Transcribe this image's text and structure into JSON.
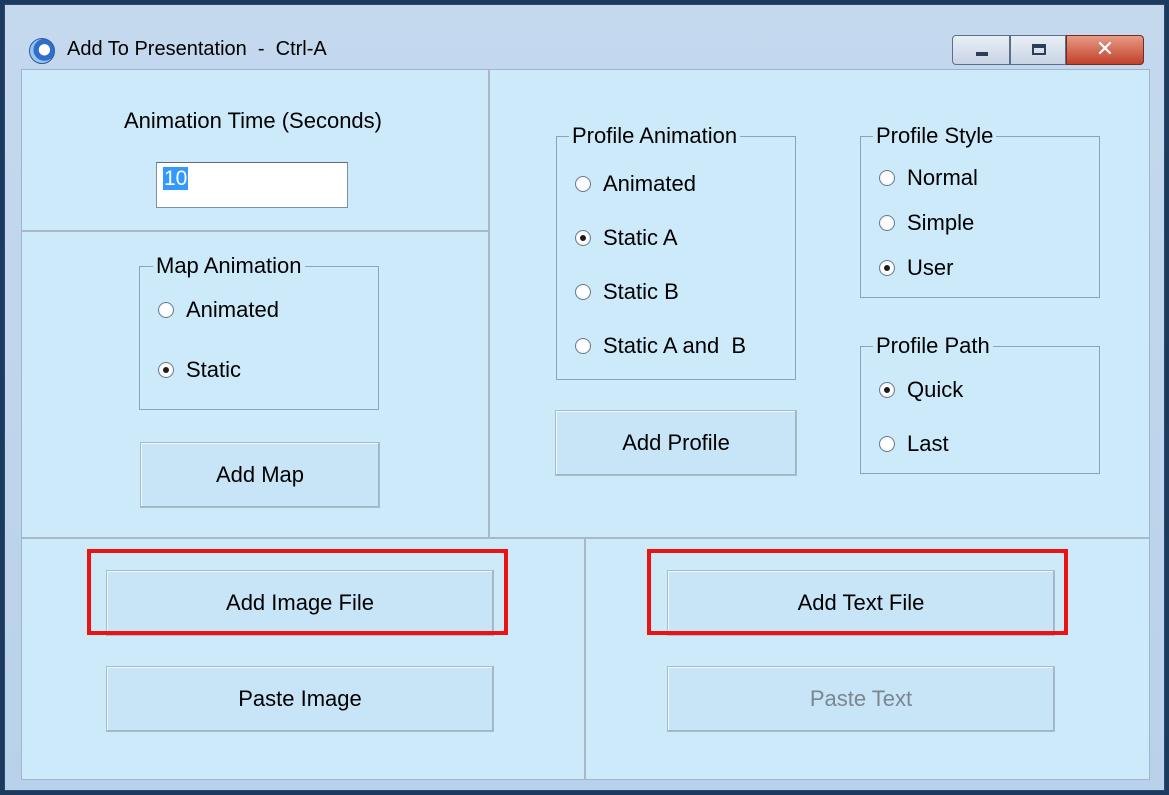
{
  "window": {
    "title": "Add To Presentation  -  Ctrl-A",
    "close_glyph": "✕"
  },
  "animation_time": {
    "label": "Animation Time (Seconds)",
    "value": "10"
  },
  "map_animation": {
    "legend": "Map Animation",
    "options": [
      {
        "label": "Animated",
        "checked": false
      },
      {
        "label": "Static",
        "checked": true
      }
    ],
    "add_button": "Add Map"
  },
  "profile_animation": {
    "legend": "Profile Animation",
    "options": [
      {
        "label": "Animated",
        "checked": false
      },
      {
        "label": "Static A",
        "checked": true
      },
      {
        "label": "Static B",
        "checked": false
      },
      {
        "label": "Static A and  B",
        "checked": false
      }
    ],
    "add_button": "Add Profile"
  },
  "profile_style": {
    "legend": "Profile Style",
    "options": [
      {
        "label": "Normal",
        "checked": false
      },
      {
        "label": "Simple",
        "checked": false
      },
      {
        "label": "User",
        "checked": true
      }
    ]
  },
  "profile_path": {
    "legend": "Profile Path",
    "options": [
      {
        "label": "Quick",
        "checked": true
      },
      {
        "label": "Last",
        "checked": false
      }
    ]
  },
  "image": {
    "add_button": "Add Image File",
    "paste_button": "Paste Image"
  },
  "text": {
    "add_button": "Add Text File",
    "paste_button": "Paste Text",
    "paste_enabled": false
  },
  "colors": {
    "client_background": "#cdeafb",
    "button_face": "#c7e5f7",
    "highlight": "#ee1111",
    "selection": "#3399ff"
  }
}
